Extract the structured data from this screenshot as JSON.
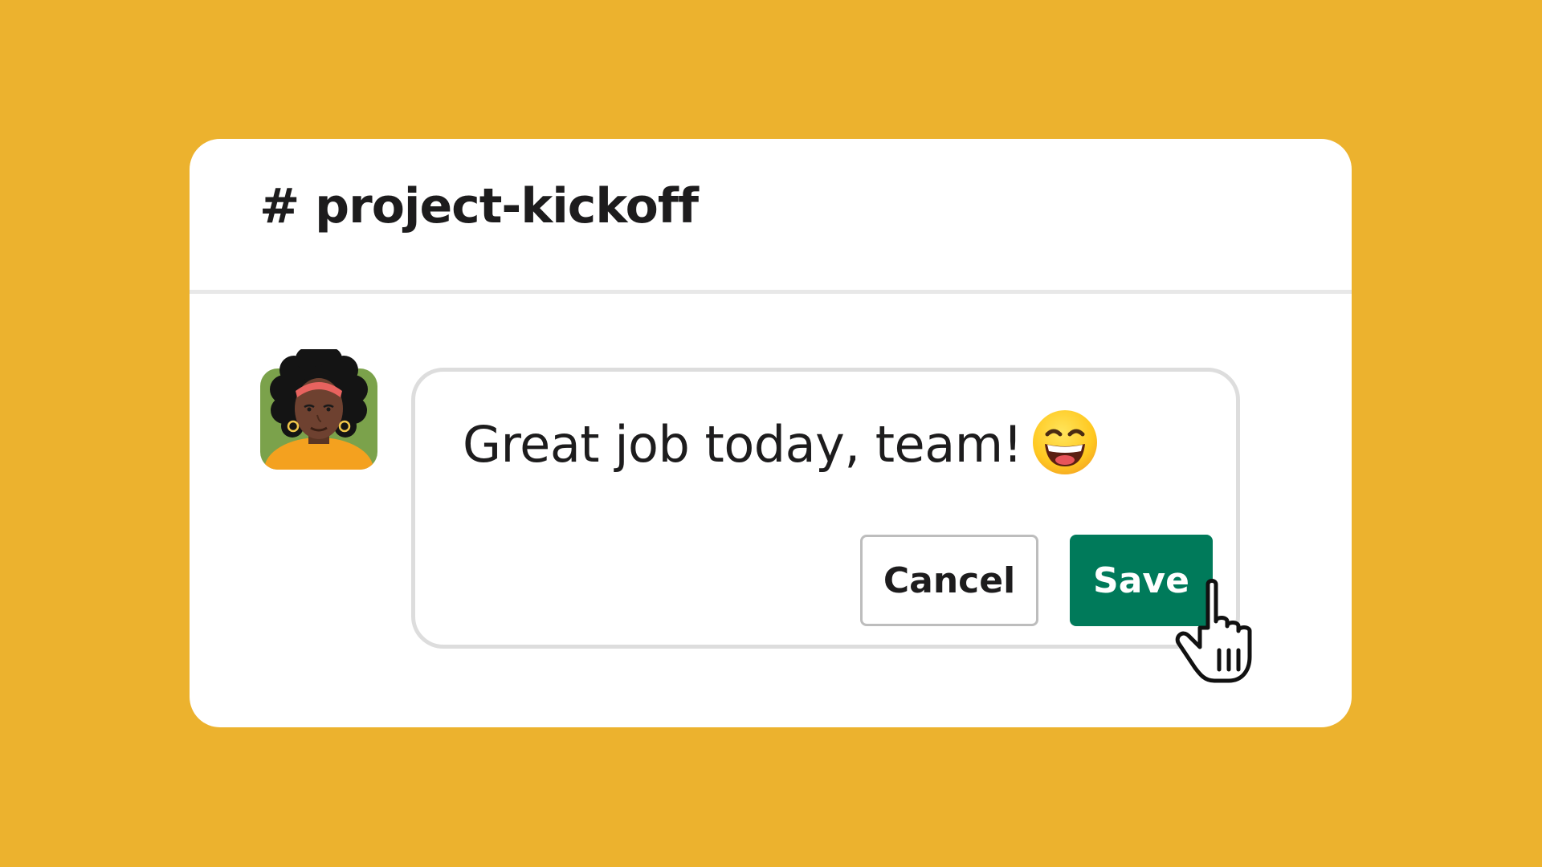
{
  "colors": {
    "background": "#ECB22E",
    "card": "#FFFFFF",
    "save_button": "#007A5A",
    "text": "#1D1C1D"
  },
  "channel": {
    "name": "# project-kickoff"
  },
  "message": {
    "avatar_icon": "user-avatar-woman",
    "text": "Great job today, team!",
    "emoji_icon": "grinning-face-with-smiling-eyes-emoji"
  },
  "actions": {
    "cancel_label": "Cancel",
    "save_label": "Save"
  },
  "pointer": {
    "icon": "hand-pointer-cursor-icon"
  }
}
